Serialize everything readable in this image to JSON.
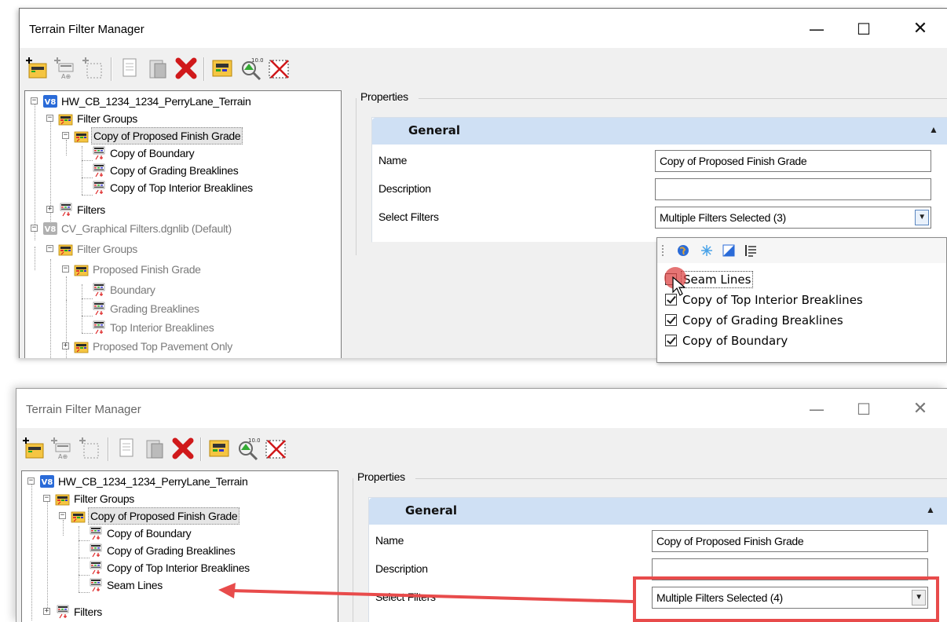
{
  "window1": {
    "title": "Terrain Filter Manager",
    "controls": {
      "minimize": "—",
      "maximize": "☐",
      "close": "✕"
    },
    "tree": {
      "root1": "HW_CB_1234_1234_PerryLane_Terrain",
      "filter_groups": "Filter Groups",
      "copy_group": "Copy of Proposed Finish Grade",
      "copy_boundary": "Copy of Boundary",
      "copy_grading": "Copy of Grading Breaklines",
      "copy_top": "Copy of Top Interior Breaklines",
      "filters": "Filters",
      "root2": "CV_Graphical Filters.dgnlib (Default)",
      "filter_groups2": "Filter Groups",
      "proposed_group": "Proposed Finish Grade",
      "boundary": "Boundary",
      "grading": "Grading Breaklines",
      "top": "Top Interior Breaklines",
      "partial": "Proposed Top Pavement Only"
    },
    "properties": {
      "label": "Properties",
      "section": "General",
      "name_label": "Name",
      "name_value": "Copy of Proposed Finish Grade",
      "description_label": "Description",
      "description_value": "",
      "select_filters_label": "Select Filters",
      "select_filters_value": "Multiple Filters Selected (3)"
    },
    "popup": {
      "items": [
        {
          "label": "Seam Lines",
          "checked": false
        },
        {
          "label": "Copy of Top Interior Breaklines",
          "checked": true
        },
        {
          "label": "Copy of Grading Breaklines",
          "checked": true
        },
        {
          "label": "Copy of Boundary",
          "checked": true
        }
      ]
    }
  },
  "window2": {
    "title": "Terrain Filter Manager",
    "controls": {
      "minimize": "—",
      "maximize": "☐",
      "close": "✕"
    },
    "tree": {
      "root1": "HW_CB_1234_1234_PerryLane_Terrain",
      "filter_groups": "Filter Groups",
      "copy_group": "Copy of Proposed Finish Grade",
      "copy_boundary": "Copy of Boundary",
      "copy_grading": "Copy of Grading Breaklines",
      "copy_top": "Copy of Top Interior Breaklines",
      "seam": "Seam Lines",
      "filters": "Filters"
    },
    "properties": {
      "label": "Properties",
      "section": "General",
      "name_label": "Name",
      "name_value": "Copy of Proposed Finish Grade",
      "description_label": "Description",
      "description_value": "",
      "select_filters_label": "Select Filters",
      "select_filters_value": "Multiple Filters Selected (4)"
    }
  },
  "colors": {
    "annotation": "#e84b4b",
    "panel_header": "#cfe0f4",
    "selection": "#e5e5e5"
  }
}
